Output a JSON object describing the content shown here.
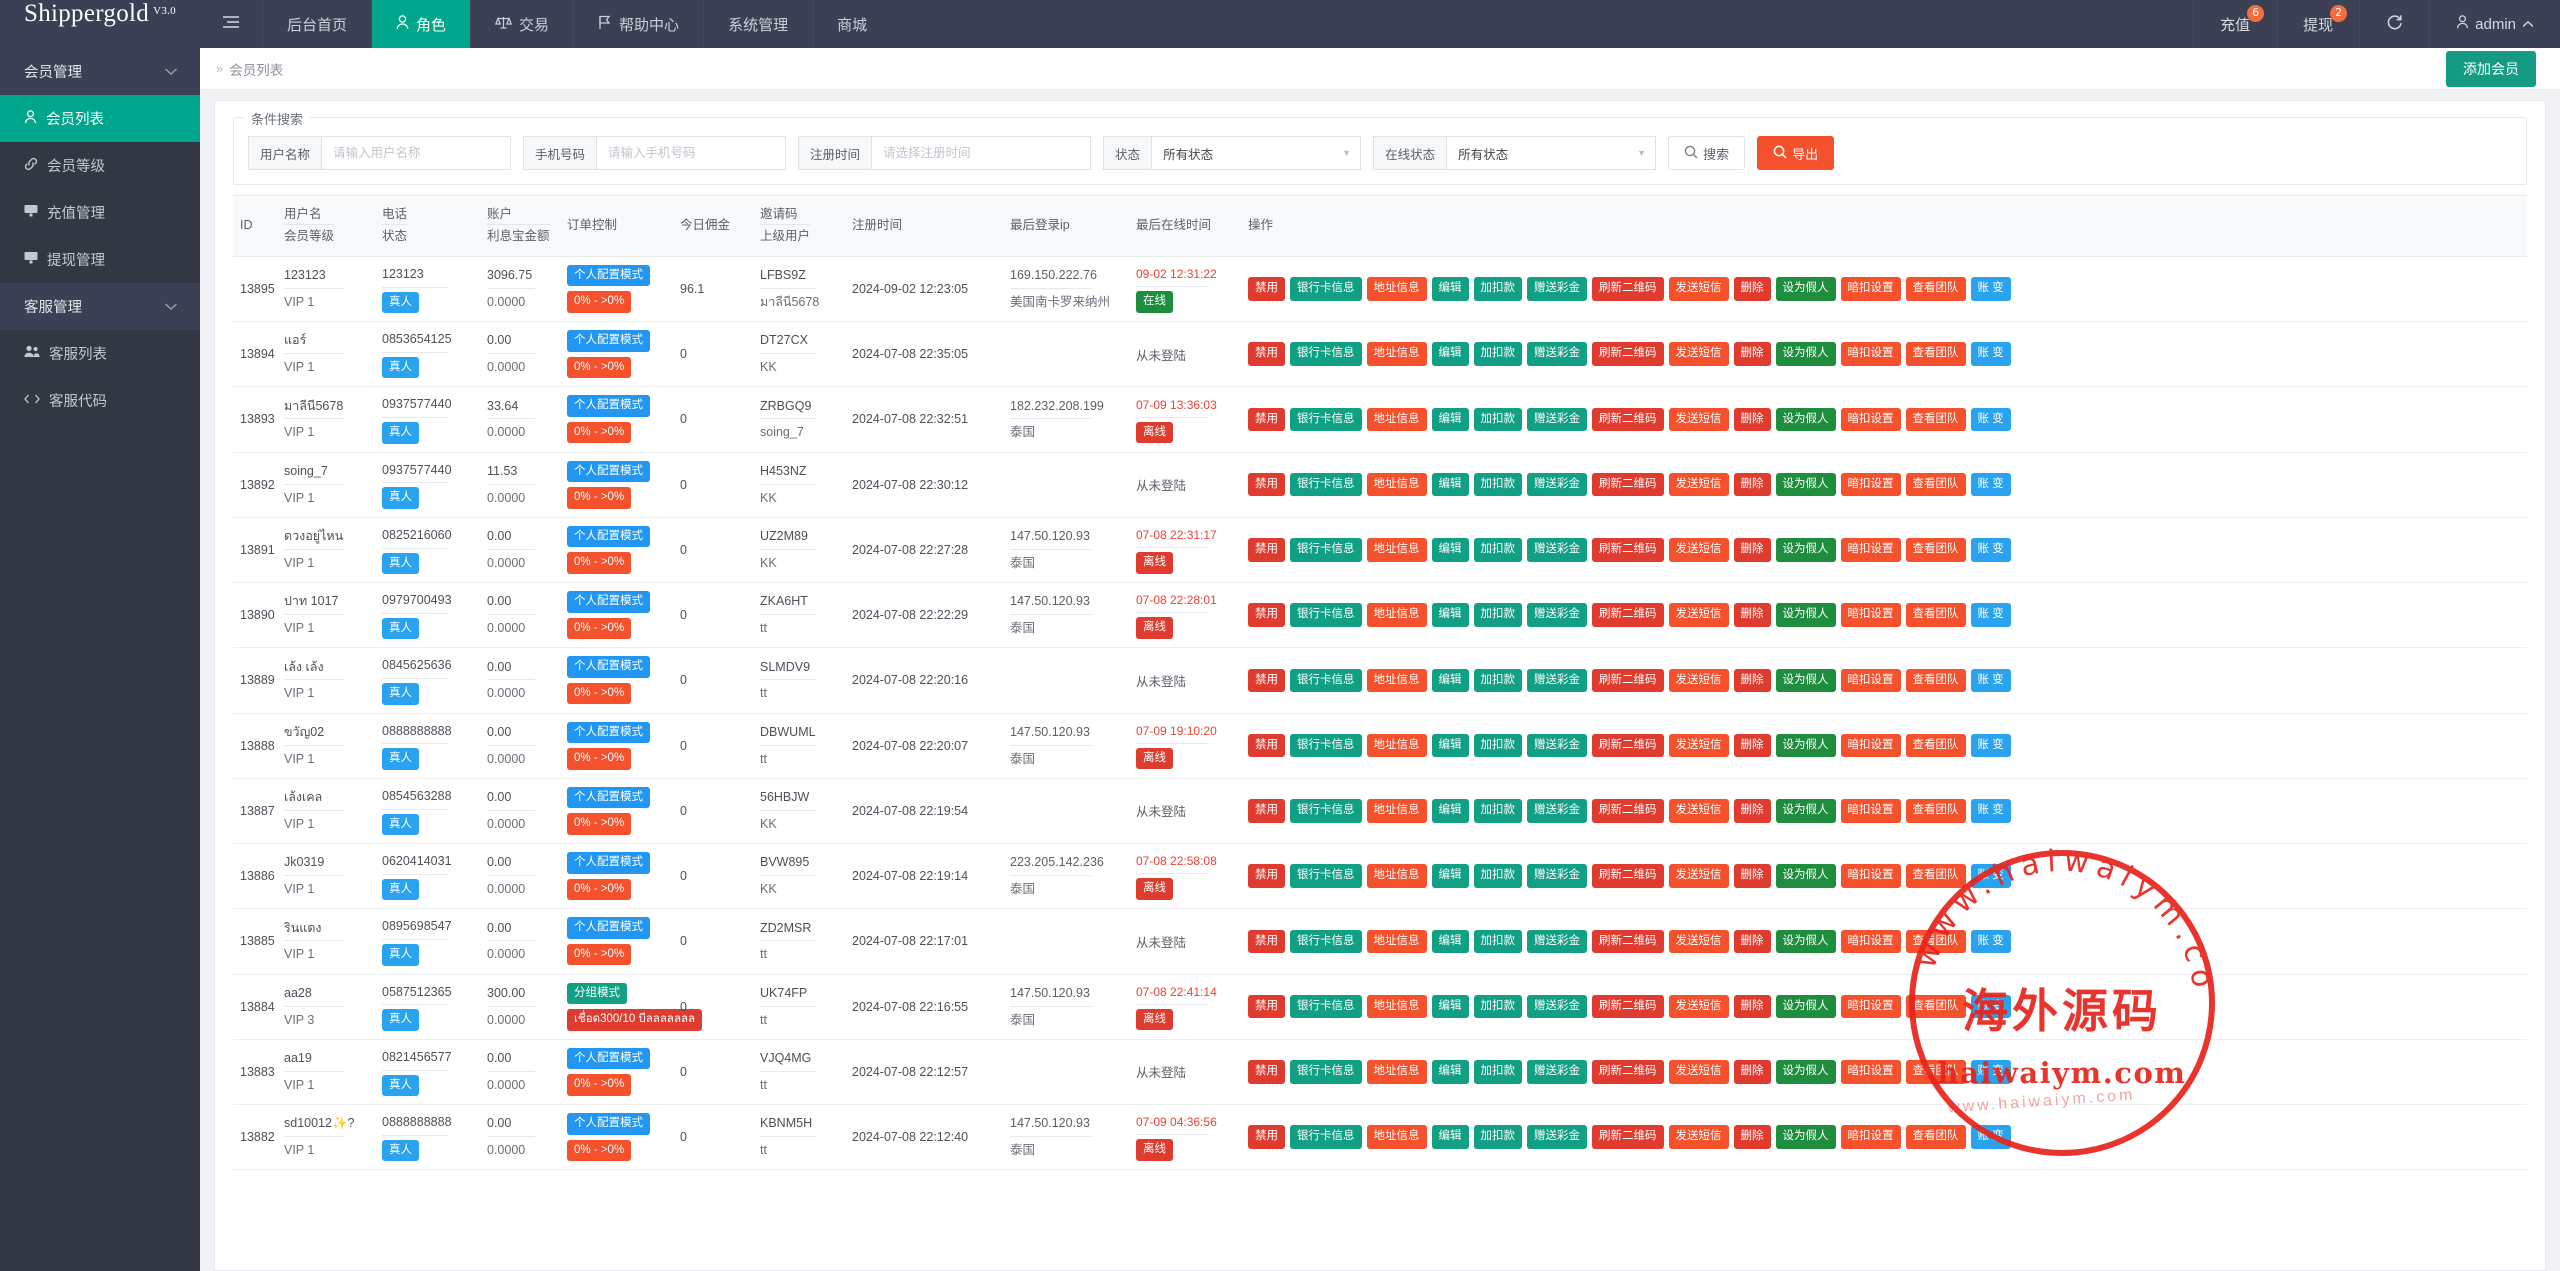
{
  "header": {
    "brand": "Shippergold",
    "brand_version": "V3.0",
    "hamburger_icon": "menu-icon",
    "nav": [
      {
        "label": "后台首页",
        "icon": "",
        "active": false
      },
      {
        "label": "角色",
        "icon": "user-icon",
        "active": true
      },
      {
        "label": "交易",
        "icon": "scales-icon",
        "active": false
      },
      {
        "label": "帮助中心",
        "icon": "flag-icon",
        "active": false
      },
      {
        "label": "系统管理",
        "icon": "",
        "active": false
      },
      {
        "label": "商城",
        "icon": "",
        "active": false
      }
    ],
    "right": {
      "recharge_label": "充值",
      "recharge_badge": "6",
      "withdraw_label": "提现",
      "withdraw_badge": "2",
      "refresh_icon": "refresh-icon",
      "user_label": "admin",
      "user_icon": "user-icon",
      "chevron": "chevron-up-icon"
    }
  },
  "sidebar": {
    "groups": [
      {
        "label": "会员管理",
        "items": [
          {
            "label": "会员列表",
            "icon": "user-icon",
            "active": true
          },
          {
            "label": "会员等级",
            "icon": "link-icon",
            "active": false
          },
          {
            "label": "充值管理",
            "icon": "screen-icon",
            "active": false
          },
          {
            "label": "提现管理",
            "icon": "screen-icon",
            "active": false
          }
        ]
      },
      {
        "label": "客服管理",
        "items": [
          {
            "label": "客服列表",
            "icon": "users-icon",
            "active": false
          },
          {
            "label": "客服代码",
            "icon": "code-icon",
            "active": false
          }
        ]
      }
    ]
  },
  "breadcrumb": {
    "arrow": "»",
    "current": "会员列表",
    "add_button": "添加会员"
  },
  "search": {
    "legend": "条件搜索",
    "username_label": "用户名称",
    "username_placeholder": "请输入用户名称",
    "username_value": "",
    "phone_label": "手机号码",
    "phone_placeholder": "请输入手机号码",
    "phone_value": "",
    "regtime_label": "注册时间",
    "regtime_placeholder": "请选择注册时间",
    "regtime_value": "",
    "status_label": "状态",
    "status_value": "所有状态",
    "online_label": "在线状态",
    "online_value": "所有状态",
    "search_button": "搜索",
    "export_button": "导出",
    "search_icon": "search-icon",
    "export_icon": "search-icon"
  },
  "table": {
    "columns": [
      {
        "l1": "ID",
        "l2": ""
      },
      {
        "l1": "用户名",
        "l2": "会员等级"
      },
      {
        "l1": "电话",
        "l2": "状态"
      },
      {
        "l1": "账户",
        "l2": "利息宝金额"
      },
      {
        "l1": "订单控制",
        "l2": ""
      },
      {
        "l1": "今日佣金",
        "l2": ""
      },
      {
        "l1": "邀请码",
        "l2": "上级用户"
      },
      {
        "l1": "注册时间",
        "l2": ""
      },
      {
        "l1": "最后登录ip",
        "l2": ""
      },
      {
        "l1": "最后在线时间",
        "l2": ""
      },
      {
        "l1": "操作",
        "l2": ""
      }
    ],
    "actions": [
      {
        "label": "禁用",
        "color": "a-red"
      },
      {
        "label": "银行卡信息",
        "color": "a-teal"
      },
      {
        "label": "地址信息",
        "color": "a-orange"
      },
      {
        "label": "编辑",
        "color": "a-teal"
      },
      {
        "label": "加扣款",
        "color": "a-teal"
      },
      {
        "label": "赠送彩金",
        "color": "a-teal"
      },
      {
        "label": "刷新二维码",
        "color": "a-red"
      },
      {
        "label": "发送短信",
        "color": "a-orange"
      },
      {
        "label": "删除",
        "color": "a-red"
      },
      {
        "label": "设为假人",
        "color": "a-green"
      },
      {
        "label": "暗扣设置",
        "color": "a-orange"
      },
      {
        "label": "查看团队",
        "color": "a-orange"
      },
      {
        "label": "账 变",
        "color": "a-blue"
      }
    ],
    "rows": [
      {
        "id": "13895",
        "username": "123123",
        "level": "VIP 1",
        "phone": "123123",
        "status": "真人",
        "account": "3096.75",
        "interest": "0.0000",
        "order_mode": "个人配置模式",
        "order_mode_color": "t-blue",
        "order_rate": "0% - >0%",
        "order_rate_color": "t-orange",
        "commission": "96.1",
        "invite": "LFBS9Z",
        "parent": "มาลีนี5678",
        "reg_time": "2024-09-02 12:23:05",
        "ip": "169.150.222.76",
        "ip_loc": "美国南卡罗来纳州",
        "last_online": "09-02 12:31:22",
        "online_state": "在线",
        "online_color": "t-darkgreen",
        "never": false
      },
      {
        "id": "13894",
        "username": "แอร์",
        "level": "VIP 1",
        "phone": "0853654125",
        "status": "真人",
        "account": "0.00",
        "interest": "0.0000",
        "order_mode": "个人配置模式",
        "order_mode_color": "t-blue",
        "order_rate": "0% - >0%",
        "order_rate_color": "t-orange",
        "commission": "0",
        "invite": "DT27CX",
        "parent": "KK",
        "reg_time": "2024-07-08 22:35:05",
        "ip": "",
        "ip_loc": "",
        "last_online": "从未登陆",
        "online_state": "",
        "online_color": "",
        "never": true
      },
      {
        "id": "13893",
        "username": "มาลีนี5678",
        "level": "VIP 1",
        "phone": "0937577440",
        "status": "真人",
        "account": "33.64",
        "interest": "0.0000",
        "order_mode": "个人配置模式",
        "order_mode_color": "t-blue",
        "order_rate": "0% - >0%",
        "order_rate_color": "t-orange",
        "commission": "0",
        "invite": "ZRBGQ9",
        "parent": "soing_7",
        "reg_time": "2024-07-08 22:32:51",
        "ip": "182.232.208.199",
        "ip_loc": "泰国",
        "last_online": "07-09 13:36:03",
        "online_state": "离线",
        "online_color": "t-red",
        "never": false
      },
      {
        "id": "13892",
        "username": "soing_7",
        "level": "VIP 1",
        "phone": "0937577440",
        "status": "真人",
        "account": "11.53",
        "interest": "0.0000",
        "order_mode": "个人配置模式",
        "order_mode_color": "t-blue",
        "order_rate": "0% - >0%",
        "order_rate_color": "t-orange",
        "commission": "0",
        "invite": "H453NZ",
        "parent": "KK",
        "reg_time": "2024-07-08 22:30:12",
        "ip": "",
        "ip_loc": "",
        "last_online": "从未登陆",
        "online_state": "",
        "online_color": "",
        "never": true
      },
      {
        "id": "13891",
        "username": "ดวงอยู่ไหน",
        "level": "VIP 1",
        "phone": "0825216060",
        "status": "真人",
        "account": "0.00",
        "interest": "0.0000",
        "order_mode": "个人配置模式",
        "order_mode_color": "t-blue",
        "order_rate": "0% - >0%",
        "order_rate_color": "t-orange",
        "commission": "0",
        "invite": "UZ2M89",
        "parent": "KK",
        "reg_time": "2024-07-08 22:27:28",
        "ip": "147.50.120.93",
        "ip_loc": "泰国",
        "last_online": "07-08 22:31:17",
        "online_state": "离线",
        "online_color": "t-red",
        "never": false
      },
      {
        "id": "13890",
        "username": "ปาท 1017",
        "level": "VIP 1",
        "phone": "0979700493",
        "status": "真人",
        "account": "0.00",
        "interest": "0.0000",
        "order_mode": "个人配置模式",
        "order_mode_color": "t-blue",
        "order_rate": "0% - >0%",
        "order_rate_color": "t-orange",
        "commission": "0",
        "invite": "ZKA6HT",
        "parent": "tt",
        "reg_time": "2024-07-08 22:22:29",
        "ip": "147.50.120.93",
        "ip_loc": "泰国",
        "last_online": "07-08 22:28:01",
        "online_state": "离线",
        "online_color": "t-red",
        "never": false
      },
      {
        "id": "13889",
        "username": "เล้ง เล้ง",
        "level": "VIP 1",
        "phone": "0845625636",
        "status": "真人",
        "account": "0.00",
        "interest": "0.0000",
        "order_mode": "个人配置模式",
        "order_mode_color": "t-blue",
        "order_rate": "0% - >0%",
        "order_rate_color": "t-orange",
        "commission": "0",
        "invite": "SLMDV9",
        "parent": "tt",
        "reg_time": "2024-07-08 22:20:16",
        "ip": "",
        "ip_loc": "",
        "last_online": "从未登陆",
        "online_state": "",
        "online_color": "",
        "never": true
      },
      {
        "id": "13888",
        "username": "ขวัญ02",
        "level": "VIP 1",
        "phone": "0888888888",
        "status": "真人",
        "account": "0.00",
        "interest": "0.0000",
        "order_mode": "个人配置模式",
        "order_mode_color": "t-blue",
        "order_rate": "0% - >0%",
        "order_rate_color": "t-orange",
        "commission": "0",
        "invite": "DBWUML",
        "parent": "tt",
        "reg_time": "2024-07-08 22:20:07",
        "ip": "147.50.120.93",
        "ip_loc": "泰国",
        "last_online": "07-09 19:10:20",
        "online_state": "离线",
        "online_color": "t-red",
        "never": false
      },
      {
        "id": "13887",
        "username": "เล้งเคล",
        "level": "VIP 1",
        "phone": "0854563288",
        "status": "真人",
        "account": "0.00",
        "interest": "0.0000",
        "order_mode": "个人配置模式",
        "order_mode_color": "t-blue",
        "order_rate": "0% - >0%",
        "order_rate_color": "t-orange",
        "commission": "0",
        "invite": "56HBJW",
        "parent": "KK",
        "reg_time": "2024-07-08 22:19:54",
        "ip": "",
        "ip_loc": "",
        "last_online": "从未登陆",
        "online_state": "",
        "online_color": "",
        "never": true
      },
      {
        "id": "13886",
        "username": "Jk0319",
        "level": "VIP 1",
        "phone": "0620414031",
        "status": "真人",
        "account": "0.00",
        "interest": "0.0000",
        "order_mode": "个人配置模式",
        "order_mode_color": "t-blue",
        "order_rate": "0% - >0%",
        "order_rate_color": "t-orange",
        "commission": "0",
        "invite": "BVW895",
        "parent": "KK",
        "reg_time": "2024-07-08 22:19:14",
        "ip": "223.205.142.236",
        "ip_loc": "泰国",
        "last_online": "07-08 22:58:08",
        "online_state": "离线",
        "online_color": "t-red",
        "never": false
      },
      {
        "id": "13885",
        "username": "รินแดง",
        "level": "VIP 1",
        "phone": "0895698547",
        "status": "真人",
        "account": "0.00",
        "interest": "0.0000",
        "order_mode": "个人配置模式",
        "order_mode_color": "t-blue",
        "order_rate": "0% - >0%",
        "order_rate_color": "t-orange",
        "commission": "0",
        "invite": "ZD2MSR",
        "parent": "tt",
        "reg_time": "2024-07-08 22:17:01",
        "ip": "",
        "ip_loc": "",
        "last_online": "从未登陆",
        "online_state": "",
        "online_color": "",
        "never": true
      },
      {
        "id": "13884",
        "username": "aa28",
        "level": "VIP 3",
        "phone": "0587512365",
        "status": "真人",
        "account": "300.00",
        "interest": "0.0000",
        "order_mode": "分组模式",
        "order_mode_color": "t-green",
        "order_rate": "เชื่อด300/10 บีลลลลลลล",
        "order_rate_color": "t-red",
        "commission": "0",
        "invite": "UK74FP",
        "parent": "tt",
        "reg_time": "2024-07-08 22:16:55",
        "ip": "147.50.120.93",
        "ip_loc": "泰国",
        "last_online": "07-08 22:41:14",
        "online_state": "离线",
        "online_color": "t-red",
        "never": false
      },
      {
        "id": "13883",
        "username": "aa19",
        "level": "VIP 1",
        "phone": "0821456577",
        "status": "真人",
        "account": "0.00",
        "interest": "0.0000",
        "order_mode": "个人配置模式",
        "order_mode_color": "t-blue",
        "order_rate": "0% - >0%",
        "order_rate_color": "t-orange",
        "commission": "0",
        "invite": "VJQ4MG",
        "parent": "tt",
        "reg_time": "2024-07-08 22:12:57",
        "ip": "",
        "ip_loc": "",
        "last_online": "从未登陆",
        "online_state": "",
        "online_color": "",
        "never": true
      },
      {
        "id": "13882",
        "username": "sd10012✨?",
        "level": "VIP 1",
        "phone": "0888888888",
        "status": "真人",
        "account": "0.00",
        "interest": "0.0000",
        "order_mode": "个人配置模式",
        "order_mode_color": "t-blue",
        "order_rate": "0% - >0%",
        "order_rate_color": "t-orange",
        "commission": "0",
        "invite": "KBNM5H",
        "parent": "tt",
        "reg_time": "2024-07-08 22:12:40",
        "ip": "147.50.120.93",
        "ip_loc": "泰国",
        "last_online": "07-09 04:36:56",
        "online_state": "离线",
        "online_color": "t-red",
        "never": false
      }
    ]
  },
  "watermark": {
    "cn_text": "海外源码",
    "en_text": "haiwaiym.com",
    "arc_text": "www.haiwaiym.com",
    "ghost_text": "www.haiwaiym.com",
    "color": "#e8231c"
  }
}
